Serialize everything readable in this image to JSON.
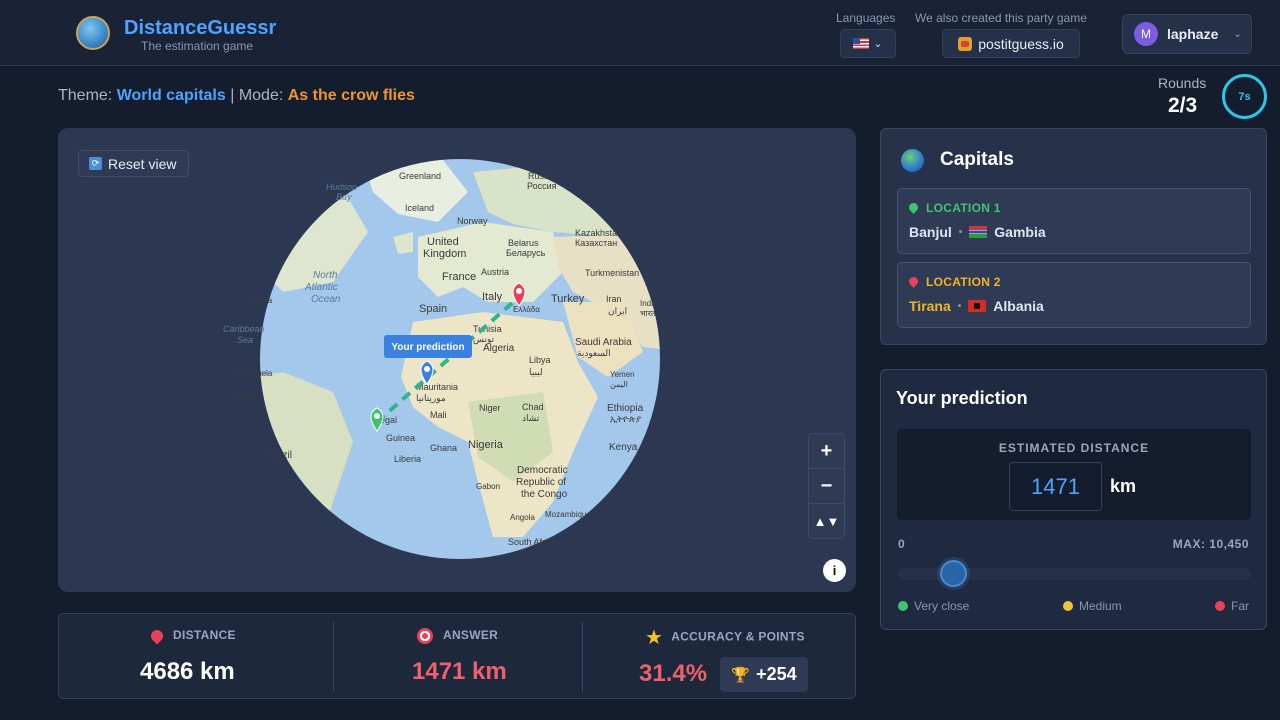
{
  "header": {
    "app_title": "DistanceGuessr",
    "app_subtitle": "The estimation game",
    "languages_label": "Languages",
    "party_label": "We also created this party game",
    "party_button": "postitguess.io",
    "user": {
      "initial": "M",
      "name": "laphaze"
    }
  },
  "game": {
    "theme_label": "Theme:",
    "theme_value": "World capitals",
    "separator": "|",
    "mode_label": "Mode:",
    "mode_value": "As the crow flies",
    "rounds_label": "Rounds",
    "rounds_value": "2/3",
    "timer": "7s"
  },
  "map": {
    "reset_label": "Reset view",
    "prediction_tooltip": "Your prediction",
    "zoom_in": "+",
    "zoom_out": "−",
    "compass": "▲▼",
    "info": "i",
    "labels": [
      "Greenland",
      "Russia",
      "Россия",
      "Hudson",
      "Bay",
      "Iceland",
      "Norway",
      "Kazakhstan",
      "Казахстан",
      "United",
      "Kingdom",
      "Belarus",
      "Беларусь",
      "North",
      "Atlantic",
      "Ocean",
      "France",
      "Austria",
      "Turkmenistan",
      "Cuba",
      "Italy",
      "Turkey",
      "Iran",
      "ایران",
      "India",
      "भारत",
      "Spain",
      "Ελλάδα",
      "Caribbean",
      "Sea",
      "Tunisia",
      "تونس",
      "Algeria",
      "Saudi Arabia",
      "السعودية",
      "Libya",
      "ليبيا",
      "Yemen",
      "اليمن",
      "Venezuela",
      "Mauritania",
      "موريتانيا",
      "Niger",
      "Chad",
      "تشاد",
      "Guyana",
      "Mali",
      "Ethiopia",
      "ኢትዮጵያ",
      "egal",
      "Guinea",
      "Ghana",
      "Nigeria",
      "Kenya",
      "Brazil",
      "Liberia",
      "Democratic",
      "Republic of",
      "the Congo",
      "Gabon",
      "Angola",
      "Mozambique",
      "South Africa"
    ]
  },
  "stats": {
    "distance_label": "DISTANCE",
    "distance_value": "4686 km",
    "answer_label": "ANSWER",
    "answer_value": "1471 km",
    "accuracy_label": "ACCURACY & POINTS",
    "accuracy_value": "31.4%",
    "points_value": "+254"
  },
  "capitals": {
    "title": "Capitals",
    "location1": {
      "label": "LOCATION 1",
      "city": "Banjul",
      "country": "Gambia"
    },
    "location2": {
      "label": "LOCATION 2",
      "city": "Tirana",
      "country": "Albania"
    }
  },
  "prediction": {
    "title": "Your prediction",
    "estimated_label": "ESTIMATED DISTANCE",
    "value": "1471",
    "unit": "km",
    "min": "0",
    "max": "MAX: 10,450",
    "slider_fraction": 0.1408,
    "legend": {
      "close": "Very close",
      "medium": "Medium",
      "far": "Far"
    }
  },
  "colors": {
    "accent_blue": "#4fa3ff",
    "accent_orange": "#f0952e",
    "error_red": "#f0606b",
    "timer_cyan": "#2ec6e8",
    "green_marker": "#3ec46d",
    "red_marker": "#e8415a"
  }
}
